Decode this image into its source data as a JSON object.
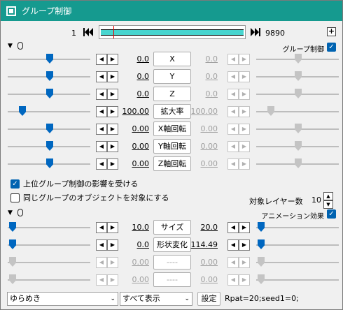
{
  "window": {
    "title": "グループ制御"
  },
  "timeline": {
    "start": "1",
    "end": "9890",
    "prev_icon": "skip-back-icon",
    "next_icon": "skip-forward-icon",
    "add_icon": "plus-icon",
    "add_label": "+"
  },
  "group_section": {
    "toggle_icon": "triangle-down-icon",
    "toggle_glyph": "▼",
    "label": "グループ制御",
    "rows": [
      {
        "left": "0.0",
        "name": "X",
        "right": "0.0"
      },
      {
        "left": "0.0",
        "name": "Y",
        "right": "0.0"
      },
      {
        "left": "0.0",
        "name": "Z",
        "right": "0.0"
      },
      {
        "left": "100.00",
        "name": "拡大率",
        "right": "100.00"
      },
      {
        "left": "0.00",
        "name": "X軸回転",
        "right": "0.00"
      },
      {
        "left": "0.00",
        "name": "Y軸回転",
        "right": "0.00"
      },
      {
        "left": "0.00",
        "name": "Z軸回転",
        "right": "0.00"
      }
    ],
    "checkbox1": "上位グループ制御の影響を受ける",
    "checkbox2": "同じグループのオブジェクトを対象にする",
    "layer_label": "対象レイヤー数",
    "layer_value": "10"
  },
  "anim_section": {
    "toggle_glyph": "▼",
    "label": "アニメーション効果",
    "rows": [
      {
        "left": "10.0",
        "name": "サイズ",
        "right": "20.0"
      },
      {
        "left": "0.0",
        "name": "形状変化",
        "right": "114.49"
      },
      {
        "left": "0.00",
        "name": "----",
        "right": "0.00"
      },
      {
        "left": "0.00",
        "name": "----",
        "right": "0.00"
      }
    ]
  },
  "bottom": {
    "effect_select": "ゆらめき",
    "display_select": "すべて表示",
    "setting_button": "設定",
    "params": "Rpat=20;seed1=0;"
  },
  "glyphs": {
    "left_arrow": "◀",
    "right_arrow": "▶",
    "check": "✓",
    "caret": "⌄",
    "up": "▲",
    "down": "▼"
  },
  "colors": {
    "titlebar": "#159a8f",
    "accent": "#0067c0",
    "timeline_bar": "#48d5cf",
    "cursor": "#e00000"
  }
}
